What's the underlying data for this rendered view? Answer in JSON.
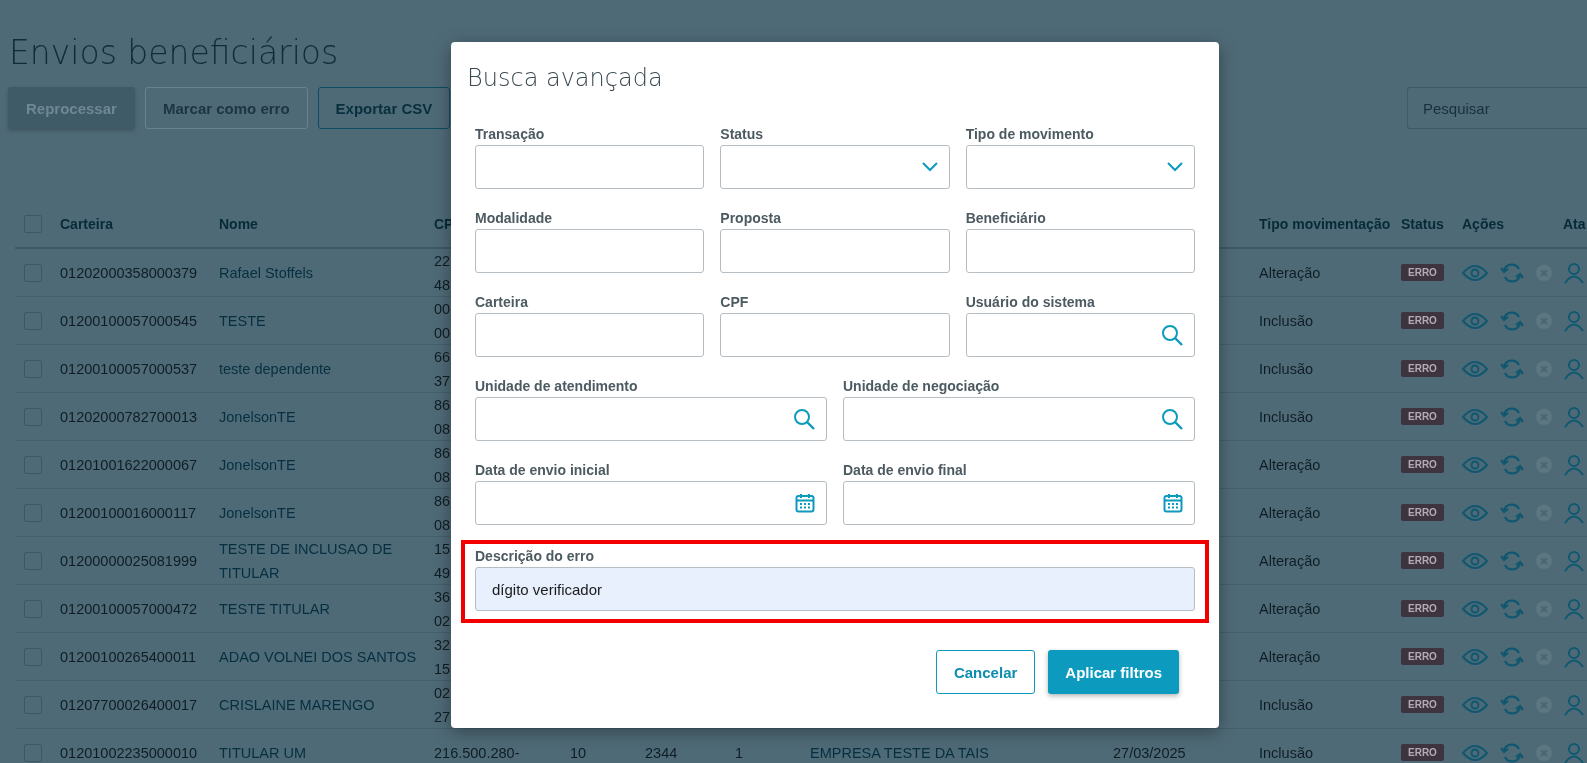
{
  "page": {
    "title": "Envios beneficiários"
  },
  "toolbar": [
    {
      "label": "Reprocessar",
      "kind": "primary",
      "disabled": true
    },
    {
      "label": "Marcar como erro",
      "kind": "secondary",
      "disabled": true
    },
    {
      "label": "Exportar CSV",
      "kind": "secondary",
      "disabled": false
    }
  ],
  "search": {
    "placeholder": "Pesquisar"
  },
  "table": {
    "all_checked": false,
    "columns": [
      "Carteira",
      "Nome",
      "CP",
      "Tipo movimentação",
      "Status",
      "Ações",
      "Ata"
    ],
    "rows": [
      {
        "carteira": "01202000358000379",
        "nome": "Rafael Stoffels",
        "cpf": [
          "22",
          "48"
        ],
        "tipo": "Alteração",
        "status": "ERRO",
        "checked": false
      },
      {
        "carteira": "01200100057000545",
        "nome": "TESTE",
        "cpf": [
          "00",
          "00"
        ],
        "tipo": "Inclusão",
        "status": "ERRO",
        "checked": false
      },
      {
        "carteira": "01200100057000537",
        "nome": "teste dependente",
        "cpf": [
          "66",
          "37"
        ],
        "tipo": "Inclusão",
        "status": "ERRO",
        "checked": false
      },
      {
        "carteira": "01202000782700013",
        "nome": "JonelsonTE",
        "cpf": [
          "86",
          "08"
        ],
        "tipo": "Inclusão",
        "status": "ERRO",
        "checked": false
      },
      {
        "carteira": "01201001622000067",
        "nome": "JonelsonTE",
        "cpf": [
          "86",
          "08"
        ],
        "tipo": "Alteração",
        "status": "ERRO",
        "checked": false
      },
      {
        "carteira": "01200100016000117",
        "nome": "JonelsonTE",
        "cpf": [
          "86",
          "08"
        ],
        "tipo": "Alteração",
        "status": "ERRO",
        "checked": false
      },
      {
        "carteira": "01200000025081999",
        "nome": "TESTE DE INCLUSAO DE TITULAR",
        "cpf": [
          "15",
          "49"
        ],
        "tipo": "Alteração",
        "status": "ERRO",
        "checked": false
      },
      {
        "carteira": "01200100057000472",
        "nome": "TESTE TITULAR",
        "cpf": [
          "36",
          "02"
        ],
        "tipo": "Alteração",
        "status": "ERRO",
        "checked": false
      },
      {
        "carteira": "01200100265400011",
        "nome": "ADAO VOLNEI DOS SANTOS",
        "cpf": [
          "32",
          "15"
        ],
        "tipo": "Alteração",
        "status": "ERRO",
        "checked": false
      },
      {
        "carteira": "01207700026400017",
        "nome": "CRISLAINE MARENGO",
        "cpf": [
          "02",
          "27"
        ],
        "tipo": "Inclusão",
        "status": "ERRO",
        "checked": false
      },
      {
        "carteira": "01201002235000010",
        "nome": "TITULAR UM",
        "cpf": [
          "216.500.280-"
        ],
        "column_4": "10",
        "column_5": "2344",
        "column_6": "1",
        "column_7": "EMPRESA TESTE DA TAIS",
        "column_8": "27/03/2025",
        "tipo": "Inclusão",
        "status": "ERRO",
        "checked": false
      }
    ]
  },
  "dialog": {
    "title": "Busca avançada",
    "rows": [
      [
        {
          "label": "Transação",
          "kind": "text"
        },
        {
          "label": "Status",
          "kind": "select"
        },
        {
          "label": "Tipo de movimento",
          "kind": "select"
        }
      ],
      [
        {
          "label": "Modalidade",
          "kind": "text"
        },
        {
          "label": "Proposta",
          "kind": "text"
        },
        {
          "label": "Beneficiário",
          "kind": "text"
        }
      ],
      [
        {
          "label": "Carteira",
          "kind": "text"
        },
        {
          "label": "CPF",
          "kind": "text"
        },
        {
          "label": "Usuário do sistema",
          "kind": "search"
        }
      ],
      [
        {
          "label": "Unidade de atendimento",
          "kind": "search"
        },
        {
          "label": "Unidade de negociação",
          "kind": "search"
        }
      ],
      [
        {
          "label": "Data de envio inicial",
          "kind": "date"
        },
        {
          "label": "Data de envio final",
          "kind": "date"
        }
      ],
      [
        {
          "label": "Descrição do erro",
          "kind": "text",
          "value": "dígito verificador",
          "highlighted": true
        }
      ]
    ],
    "buttons": [
      {
        "label": "Cancelar",
        "kind": "secondary"
      },
      {
        "label": "Aplicar filtros",
        "kind": "primary"
      }
    ]
  }
}
